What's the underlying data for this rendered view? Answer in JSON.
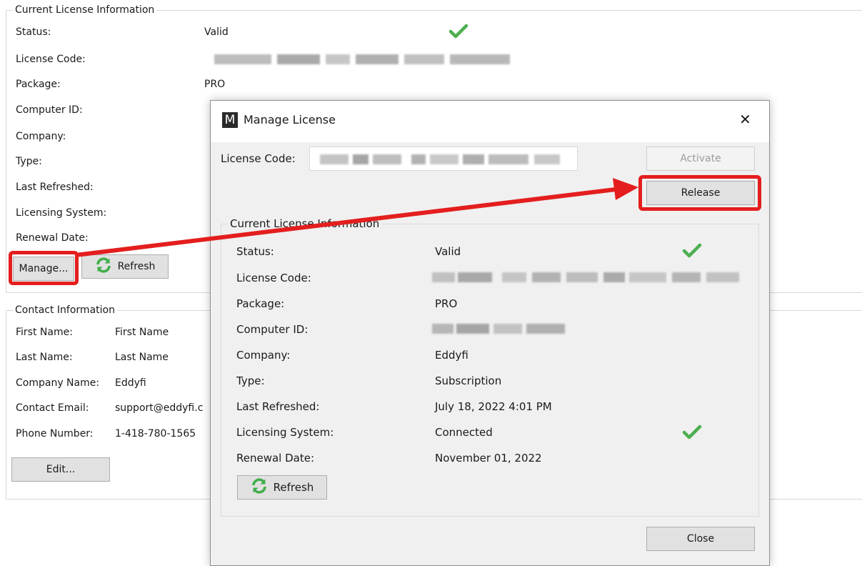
{
  "background": {
    "license_group": {
      "title": "Current License Information",
      "status_label": "Status:",
      "status_value": "Valid",
      "license_code_label": "License Code:",
      "package_label": "Package:",
      "package_value": "PRO",
      "computer_id_label": "Computer ID:",
      "company_label": "Company:",
      "type_label": "Type:",
      "last_refreshed_label": "Last Refreshed:",
      "licensing_system_label": "Licensing System:",
      "renewal_date_label": "Renewal Date:",
      "manage_button": "Manage...",
      "refresh_button": "Refresh"
    },
    "contact_group": {
      "title": "Contact Information",
      "first_name_label": "First Name:",
      "first_name_value": "First Name",
      "last_name_label": "Last Name:",
      "last_name_value": "Last Name",
      "company_name_label": "Company Name:",
      "company_name_value": "Eddyfi",
      "contact_email_label": "Contact Email:",
      "contact_email_value": "support@eddyfi.c",
      "phone_label": "Phone Number:",
      "phone_value": "1-418-780-1565",
      "edit_button": "Edit..."
    }
  },
  "dialog": {
    "app_icon_letter": "M",
    "title": "Manage License",
    "close_glyph": "✕",
    "license_code_label": "License Code:",
    "activate_button": "Activate",
    "release_button": "Release",
    "group_title": "Current License Information",
    "status_label": "Status:",
    "status_value": "Valid",
    "license_code_row_label": "License Code:",
    "package_label": "Package:",
    "package_value": "PRO",
    "computer_id_label": "Computer ID:",
    "company_label": "Company:",
    "company_value": "Eddyfi",
    "type_label": "Type:",
    "type_value": "Subscription",
    "last_refreshed_label": "Last Refreshed:",
    "last_refreshed_value": "July 18, 2022 4:01 PM",
    "licensing_system_label": "Licensing System:",
    "licensing_system_value": "Connected",
    "renewal_date_label": "Renewal Date:",
    "renewal_date_value": "November 01, 2022",
    "refresh_button": "Refresh",
    "close_button": "Close"
  },
  "colors": {
    "check_green": "#4caf50",
    "annotation_red": "#e41e1e",
    "refresh_green": "#3fae49"
  },
  "icons": {
    "status_check": "checkmark-icon",
    "refresh": "refresh-icon",
    "app": "app-logo-icon",
    "close": "close-icon"
  }
}
